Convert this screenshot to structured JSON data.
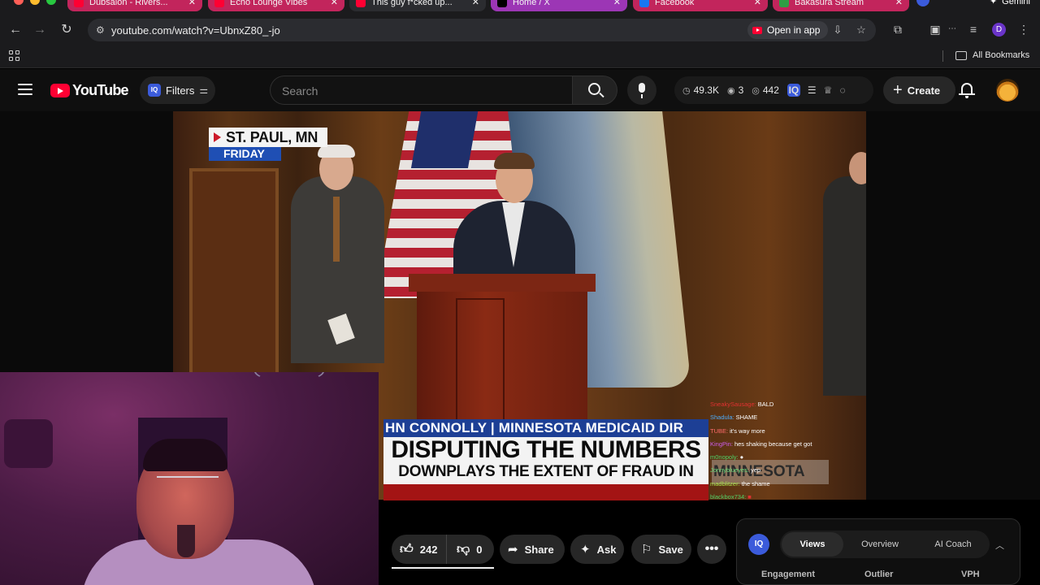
{
  "browser": {
    "tabs": [
      {
        "title": "Dubsalon - Rivers...",
        "color": "#c2255c",
        "fav": "#ff0033"
      },
      {
        "title": "Echo Lounge Vibes",
        "color": "#c2255c",
        "fav": "#ff0033"
      },
      {
        "title": "This guy f*cked up...",
        "color": "#2b2c30",
        "fav": "#ff0033"
      },
      {
        "title": "Home / X",
        "color": "#9c36b5",
        "fav": "#000000"
      },
      {
        "title": "Facebook",
        "color": "#c2255c",
        "fav": "#1877f2"
      },
      {
        "title": "Bakasura Stream",
        "color": "#c2255c",
        "fav": "#2f9e44"
      }
    ],
    "gemini_label": "Gemini",
    "url": "youtube.com/watch?v=UbnxZ80_-jo",
    "open_in_app": "Open in app",
    "profile_initial": "D",
    "all_bookmarks": "All Bookmarks"
  },
  "masthead": {
    "logo_text": "YouTube",
    "filters_label": "Filters",
    "iq_label": "IQ",
    "search_placeholder": "Search",
    "stats": {
      "views": "49.3K",
      "watching": "3",
      "viewers": "442"
    },
    "create_label": "Create"
  },
  "video": {
    "location_city": "ST. PAUL, MN",
    "location_day": "FRIDAY",
    "lower_third_name": "HN CONNOLLY | MINNESOTA MEDICAID DIR",
    "lower_third_headline": "DISPUTING THE NUMBERS",
    "lower_third_sub": "DOWNPLAYS THE EXTENT OF FRAUD IN",
    "lower_third_overflow": "MINNESOTA"
  },
  "chat": [
    {
      "user": "SneakySausage:",
      "msg": "BALD",
      "color": "#e03131"
    },
    {
      "user": "Shadula:",
      "msg": "SHAME",
      "color": "#4dabf7"
    },
    {
      "user": "TUBE:",
      "msg": "it's way more",
      "color": "#ff6b6b"
    },
    {
      "user": "KingPin:",
      "msg": "hes shaking because get got",
      "color": "#cc5de8"
    },
    {
      "user": "m0nopoly:",
      "msg": "",
      "color": "#51cf66"
    },
    {
      "user": "Jonnyblueyes:",
      "msg": "yep",
      "color": "#69db7c"
    },
    {
      "user": "madblitzer:",
      "msg": "the shame",
      "color": "#a9e34b"
    },
    {
      "user": "blackbox734:",
      "msg": "",
      "color": "#51cf66"
    }
  ],
  "actions": {
    "likes": "242",
    "like_ratio": 1.0,
    "dislikes": "0",
    "share": "Share",
    "ask": "Ask",
    "save": "Save"
  },
  "panel": {
    "iq_label": "IQ",
    "tabs": [
      "Views",
      "Overview",
      "AI Coach"
    ],
    "active_tab": "Views",
    "columns": [
      "Engagement",
      "Outlier",
      "VPH"
    ]
  }
}
